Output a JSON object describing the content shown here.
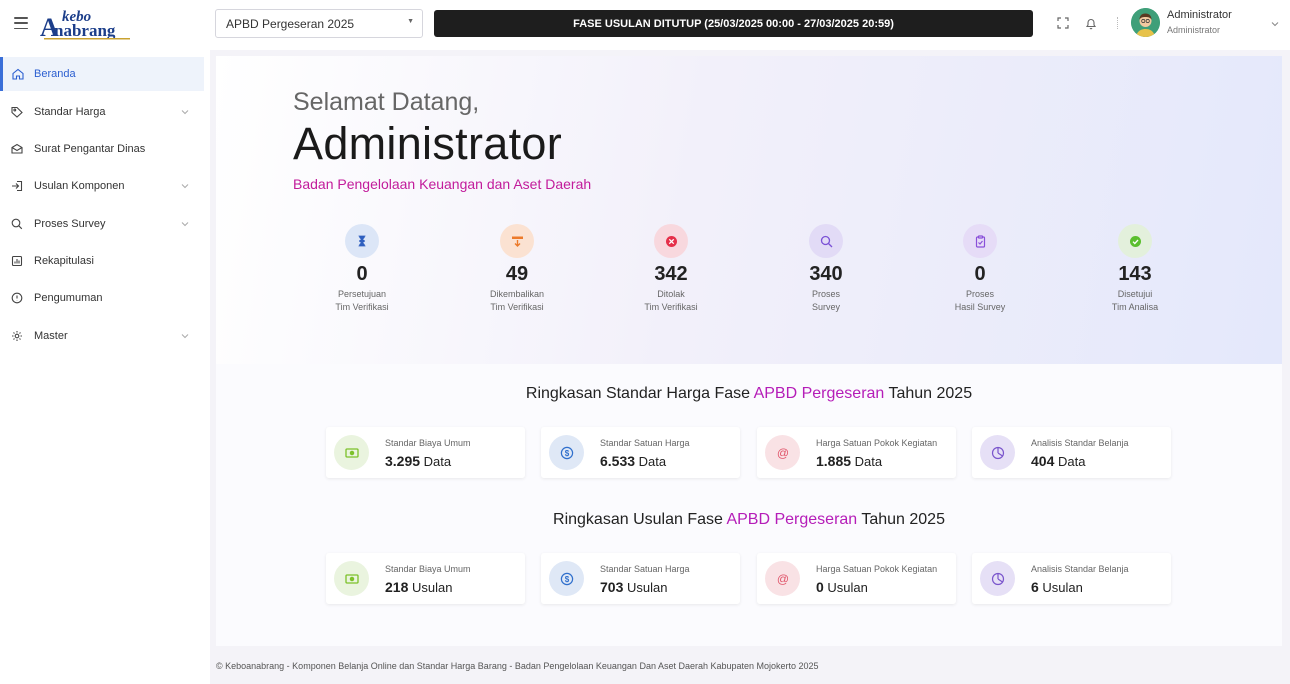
{
  "brand": {
    "logo_text": "kebo anabrang"
  },
  "header": {
    "period_selected": "APBD Pergeseran 2025",
    "phase_banner": "FASE USULAN DITUTUP (25/03/2025 00:00 - 27/03/2025 20:59)",
    "user_name": "Administrator",
    "user_role": "Administrator"
  },
  "sidebar": {
    "items": [
      {
        "label": "Beranda",
        "icon": "home-icon",
        "active": true
      },
      {
        "label": "Standar Harga",
        "icon": "tag-icon",
        "expandable": true
      },
      {
        "label": "Surat Pengantar Dinas",
        "icon": "envelope-icon"
      },
      {
        "label": "Usulan Komponen",
        "icon": "login-icon",
        "expandable": true
      },
      {
        "label": "Proses Survey",
        "icon": "search-icon",
        "expandable": true
      },
      {
        "label": "Rekapitulasi",
        "icon": "report-icon"
      },
      {
        "label": "Pengumuman",
        "icon": "info-icon"
      },
      {
        "label": "Master",
        "icon": "gear-icon",
        "expandable": true
      }
    ]
  },
  "hero": {
    "greeting": "Selamat Datang,",
    "name": "Administrator",
    "agency": "Badan Pengelolaan Keuangan dan Aset Daerah"
  },
  "stats": [
    {
      "value": "0",
      "line1": "Persetujuan",
      "line2": "Tim Verifikasi",
      "icon": "hourglass-icon",
      "color": "#2f5fbf",
      "bg": "#dce6f7"
    },
    {
      "value": "49",
      "line1": "Dikembalikan",
      "line2": "Tim Verifikasi",
      "icon": "return-icon",
      "color": "#ec7a2a",
      "bg": "#fbe2d2"
    },
    {
      "value": "342",
      "line1": "Ditolak",
      "line2": "Tim Verifikasi",
      "icon": "x-circle-icon",
      "color": "#e5304a",
      "bg": "#f8d8de"
    },
    {
      "value": "340",
      "line1": "Proses",
      "line2": "Survey",
      "icon": "search-icon",
      "color": "#7b52d6",
      "bg": "#e2dbf6"
    },
    {
      "value": "0",
      "line1": "Proses",
      "line2": "Hasil Survey",
      "icon": "clipboard-icon",
      "color": "#8a4fd9",
      "bg": "#e6dcf7"
    },
    {
      "value": "143",
      "line1": "Disetujui",
      "line2": "Tim Analisa",
      "icon": "check-circle-icon",
      "color": "#5bbf2e",
      "bg": "#e3f0dc"
    }
  ],
  "summary_standar": {
    "prefix": "Ringkasan Standar Harga Fase ",
    "accent": "APBD Pergeseran",
    "suffix": " Tahun 2025",
    "cards": [
      {
        "title": "Standar Biaya Umum",
        "value": "3.295",
        "unit": " Data",
        "icon": "money-icon",
        "color": "#7cc12a",
        "bg": "#eaf4df"
      },
      {
        "title": "Standar Satuan Harga",
        "value": "6.533",
        "unit": " Data",
        "icon": "dollar-icon",
        "color": "#2f6fcc",
        "bg": "#dfe8f6"
      },
      {
        "title": "Harga Satuan Pokok Kegiatan",
        "value": "1.885",
        "unit": " Data",
        "icon": "at-icon",
        "color": "#e0556a",
        "bg": "#f9e2e5"
      },
      {
        "title": "Analisis Standar Belanja",
        "value": "404",
        "unit": " Data",
        "icon": "pie-icon",
        "color": "#7a55cc",
        "bg": "#e6e0f6"
      }
    ]
  },
  "summary_usulan": {
    "prefix": "Ringkasan Usulan Fase ",
    "accent": "APBD Pergeseran",
    "suffix": " Tahun 2025",
    "cards": [
      {
        "title": "Standar Biaya Umum",
        "value": "218",
        "unit": " Usulan",
        "icon": "money-icon",
        "color": "#7cc12a",
        "bg": "#eaf4df"
      },
      {
        "title": "Standar Satuan Harga",
        "value": "703",
        "unit": " Usulan",
        "icon": "dollar-icon",
        "color": "#2f6fcc",
        "bg": "#dfe8f6"
      },
      {
        "title": "Harga Satuan Pokok Kegiatan",
        "value": "0",
        "unit": " Usulan",
        "icon": "at-icon",
        "color": "#e0556a",
        "bg": "#f9e2e5"
      },
      {
        "title": "Analisis Standar Belanja",
        "value": "6",
        "unit": " Usulan",
        "icon": "pie-icon",
        "color": "#7a55cc",
        "bg": "#e6e0f6"
      }
    ]
  },
  "footer": {
    "text": "© Keboanabrang - Komponen Belanja Online dan Standar Harga Barang - Badan Pengelolaan Keuangan Dan Aset Daerah Kabupaten Mojokerto 2025"
  }
}
